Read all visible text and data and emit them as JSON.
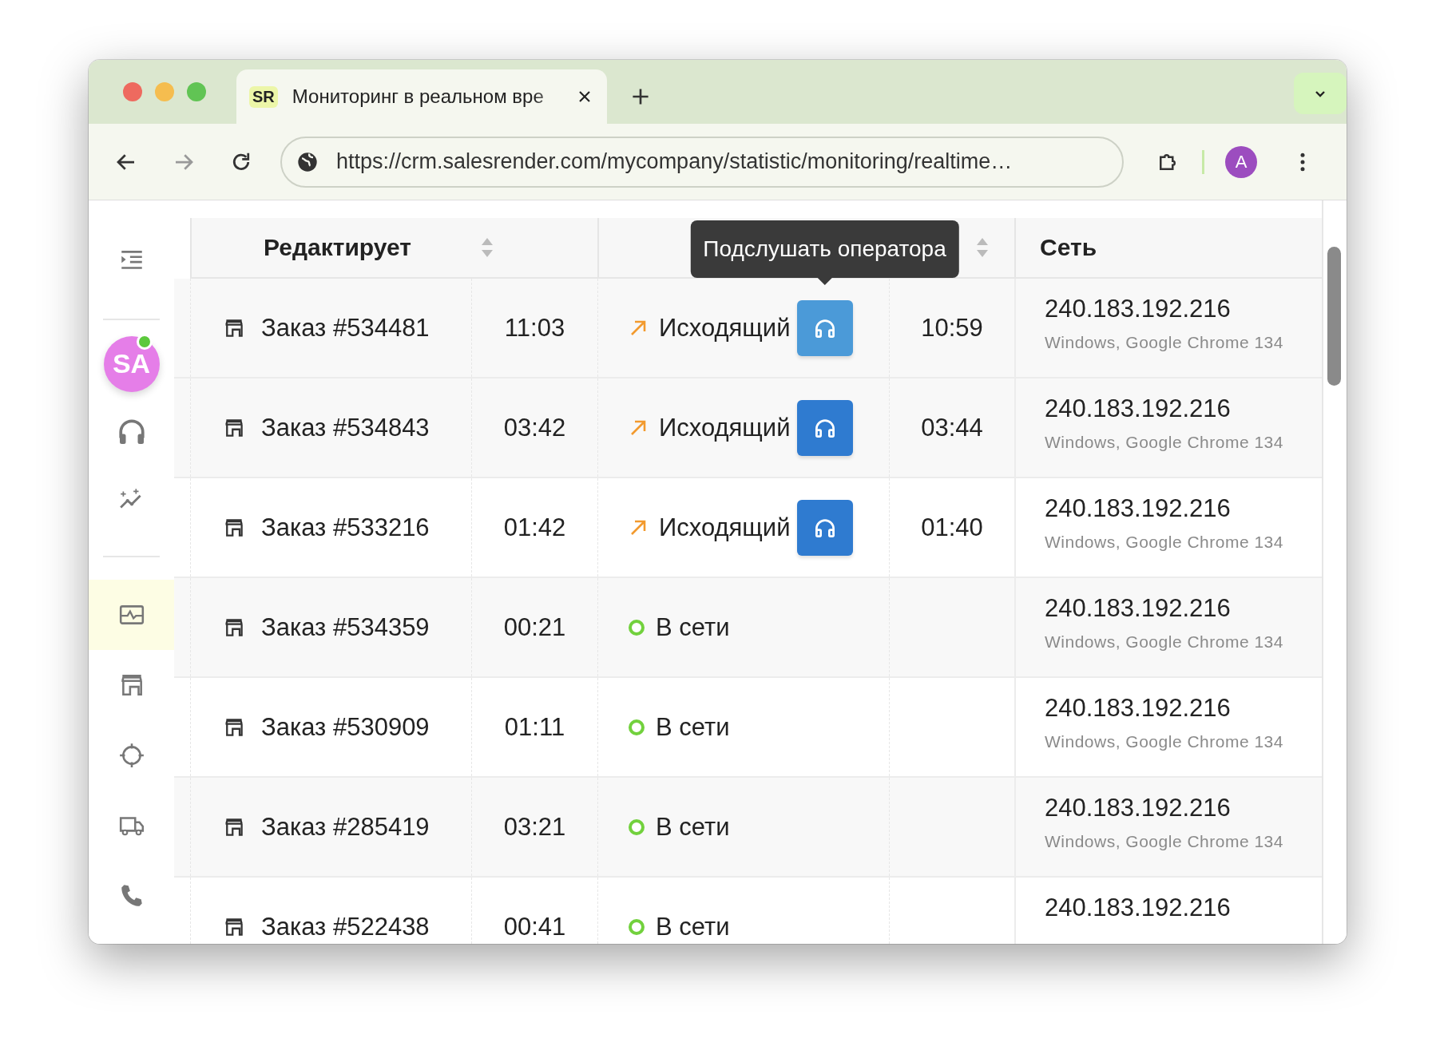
{
  "browser": {
    "tab": {
      "favicon": "SR",
      "title": "Мониторинг в реальном вре"
    },
    "url": "https://crm.salesrender.com/mycompany/statistic/monitoring/realtime…",
    "profile": "A"
  },
  "sidebar": {
    "groups": [
      [
        {
          "kind": "menu",
          "selected": false
        }
      ],
      [
        {
          "kind": "avatar",
          "initials": "SA",
          "online": true,
          "selected": false
        },
        {
          "kind": "headset",
          "selected": false
        },
        {
          "kind": "chart",
          "selected": false
        }
      ],
      [
        {
          "kind": "monitor",
          "selected": true
        },
        {
          "kind": "store",
          "selected": false
        },
        {
          "kind": "target",
          "selected": false
        },
        {
          "kind": "truck",
          "selected": false
        },
        {
          "kind": "phone",
          "selected": false
        }
      ]
    ]
  },
  "table": {
    "columns": [
      {
        "label": "Редактирует",
        "sortable": true
      },
      {
        "sortable": true
      },
      {
        "label": "Сеть",
        "sortable": false
      }
    ],
    "rows": [
      {
        "kind": "call",
        "order": "Заказ #534481",
        "time": "11:03",
        "direction": "Исходящий",
        "hovered": true,
        "tooltip": "Подслушать оператора",
        "call_time": "10:59",
        "ip": "240.183.192.216",
        "client": "Windows, Google Chrome 134"
      },
      {
        "kind": "call",
        "order": "Заказ #534843",
        "time": "03:42",
        "direction": "Исходящий",
        "hovered": false,
        "call_time": "03:44",
        "ip": "240.183.192.216",
        "client": "Windows, Google Chrome 134"
      },
      {
        "kind": "call",
        "order": "Заказ #533216",
        "time": "01:42",
        "direction": "Исходящий",
        "hovered": false,
        "call_time": "01:40",
        "ip": "240.183.192.216",
        "client": "Windows, Google Chrome 134"
      },
      {
        "kind": "online",
        "order": "Заказ #534359",
        "time": "00:21",
        "status": "В сети",
        "ip": "240.183.192.216",
        "client": "Windows, Google Chrome 134"
      },
      {
        "kind": "online",
        "order": "Заказ #530909",
        "time": "01:11",
        "status": "В сети",
        "ip": "240.183.192.216",
        "client": "Windows, Google Chrome 134"
      },
      {
        "kind": "online",
        "order": "Заказ #285419",
        "time": "03:21",
        "status": "В сети",
        "ip": "240.183.192.216",
        "client": "Windows, Google Chrome 134"
      },
      {
        "kind": "online",
        "order": "Заказ #522438",
        "time": "00:41",
        "status": "В сети",
        "ip": "240.183.192.216"
      }
    ]
  }
}
